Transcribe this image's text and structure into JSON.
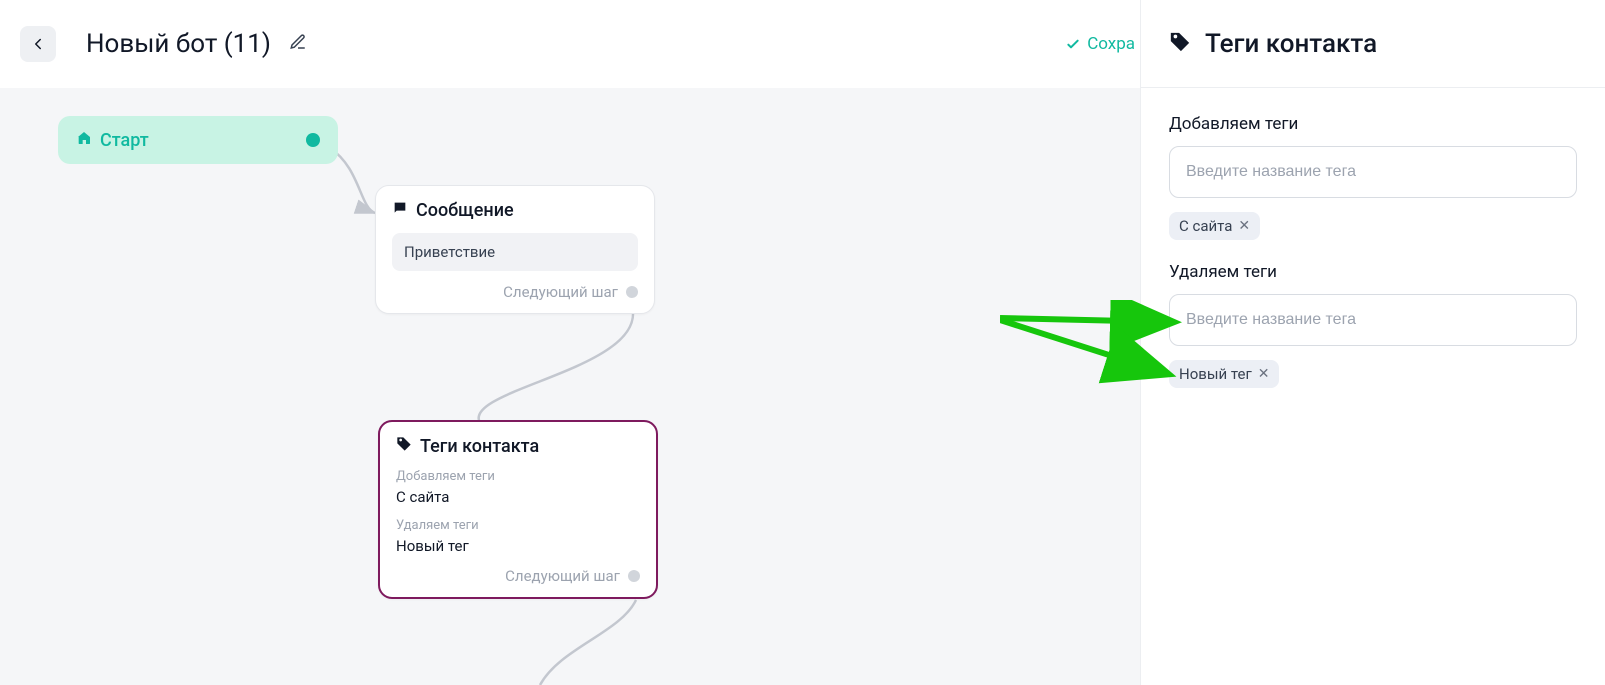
{
  "header": {
    "bot_name": "Новый бот (11)",
    "save_status": "Сохра"
  },
  "nodes": {
    "start": {
      "label": "Старт"
    },
    "message": {
      "title": "Сообщение",
      "content": "Приветствие",
      "next_label": "Следующий шаг"
    },
    "tags": {
      "title": "Теги контакта",
      "add_label": "Добавляем теги",
      "add_value": "С сайта",
      "remove_label": "Удаляем теги",
      "remove_value": "Новый тег",
      "next_label": "Следующий шаг"
    }
  },
  "panel": {
    "title": "Теги контакта",
    "add_section_label": "Добавляем теги",
    "add_placeholder": "Введите название тега",
    "add_chip": "С сайта",
    "remove_section_label": "Удаляем теги",
    "remove_placeholder": "Введите название тега",
    "remove_chip": "Новый тег"
  }
}
